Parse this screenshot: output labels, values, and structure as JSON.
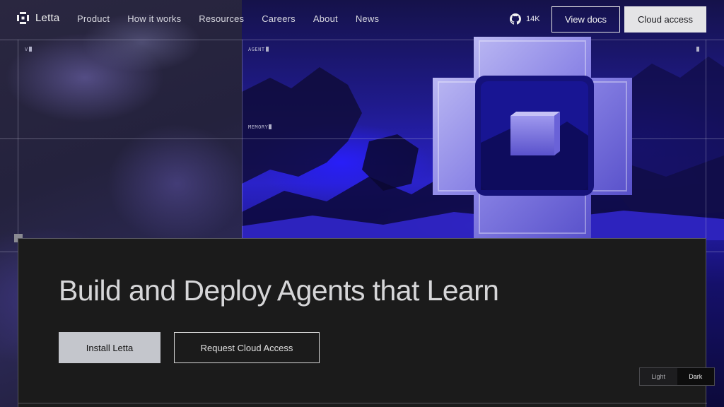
{
  "nav": {
    "brand": "Letta",
    "links": [
      "Product",
      "How it works",
      "Resources",
      "Careers",
      "About",
      "News"
    ],
    "github_stars": "14K",
    "view_docs": "View docs",
    "cloud_access": "Cloud access"
  },
  "tags": {
    "top_left": "V",
    "agent": "AGENT",
    "memory": "MEMORY"
  },
  "hero": {
    "headline": "Build and Deploy Agents that Learn",
    "install_button": "Install Letta",
    "request_button": "Request Cloud Access"
  },
  "theme_toggle": {
    "light": "Light",
    "dark": "Dark",
    "active": "dark"
  },
  "colors": {
    "accent_blue": "#2a22c9",
    "panel_bg": "#1b1b1b",
    "primary_button": "#e4e4e6"
  },
  "icons": {
    "brand": "letta-logo-icon",
    "github": "github-icon"
  }
}
